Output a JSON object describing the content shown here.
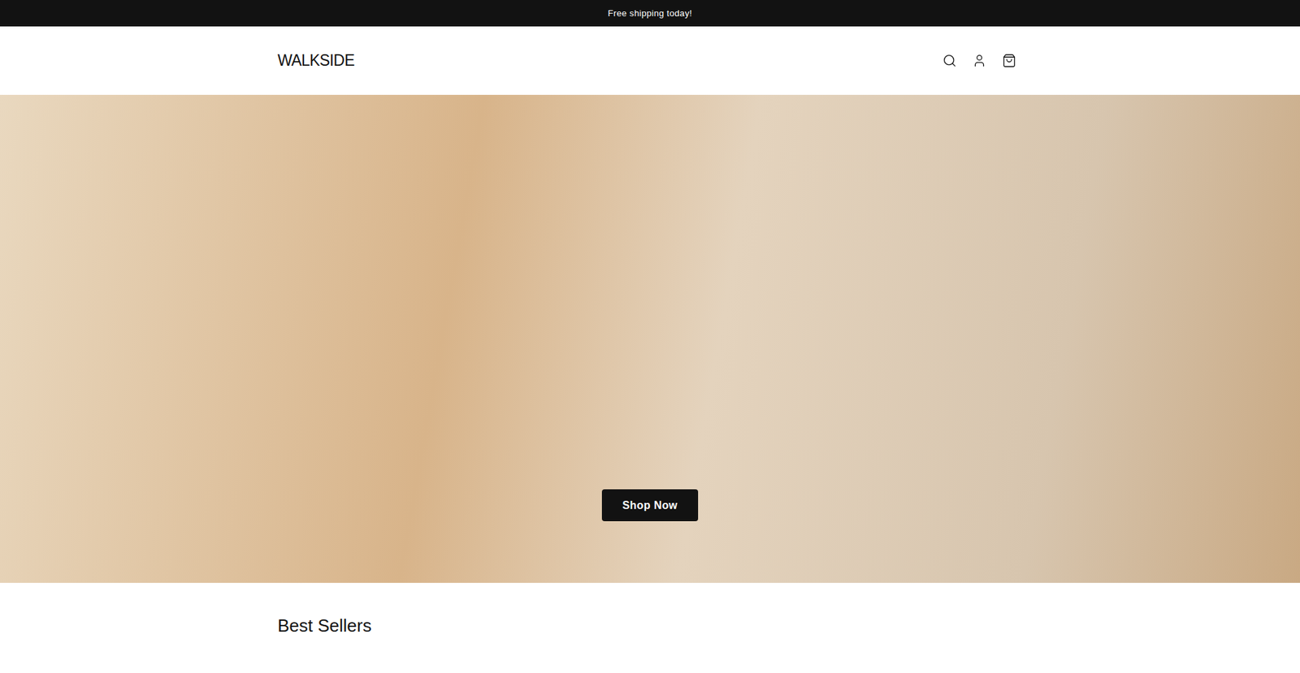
{
  "announcement": {
    "text": "Free shipping today!"
  },
  "header": {
    "logo": "WALKSIDE",
    "icons": [
      "search",
      "account",
      "cart"
    ]
  },
  "hero": {
    "button": "Shop Now"
  },
  "section": {
    "title": "Best Sellers"
  }
}
